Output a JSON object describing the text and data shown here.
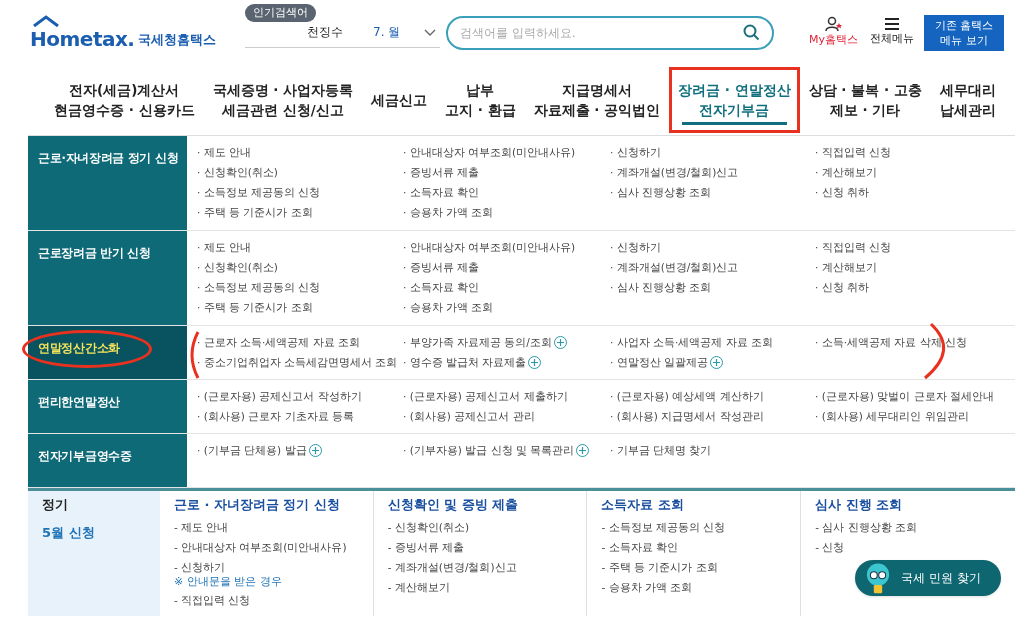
{
  "header": {
    "logo": {
      "wordmark": "Hometax.",
      "name": "국세청홈택스"
    },
    "popular": {
      "badge": "인기검색어",
      "items": [
        "천징수",
        "7. 월"
      ]
    },
    "search": {
      "placeholder": "검색어를 입력하세요."
    },
    "my_link": "My홈택스",
    "menu_link": "전체메뉴",
    "legacy_button": [
      "기존 홈택스",
      "메뉴 보기"
    ]
  },
  "nav": [
    {
      "lines": [
        "전자(세금)계산서",
        "현금영수증 · 신용카드"
      ],
      "selected": false,
      "highlighted": false
    },
    {
      "lines": [
        "국세증명 · 사업자등록",
        "세금관련 신청/신고"
      ],
      "selected": false,
      "highlighted": false
    },
    {
      "lines": [
        "세금신고"
      ],
      "selected": false,
      "highlighted": false
    },
    {
      "lines": [
        "납부",
        "고지 · 환급"
      ],
      "selected": false,
      "highlighted": false
    },
    {
      "lines": [
        "지급명세서",
        "자료제출 · 공익법인"
      ],
      "selected": false,
      "highlighted": false
    },
    {
      "lines": [
        "장려금 · 연말정산",
        "전자기부금"
      ],
      "selected": true,
      "highlighted": true
    },
    {
      "lines": [
        "상담 · 불복 · 고충",
        "제보 · 기타"
      ],
      "selected": false,
      "highlighted": false
    },
    {
      "lines": [
        "세무대리",
        "납세관리"
      ],
      "selected": false,
      "highlighted": false
    }
  ],
  "menu": [
    {
      "title": "근로·자녀장려금 정기 신청",
      "selected": false,
      "highlighted": false,
      "items": [
        {
          "label": "· 제도 안내",
          "plus": false
        },
        {
          "label": "· 안내대상자 여부조회(미안내사유)",
          "plus": false
        },
        {
          "label": "· 신청하기",
          "plus": false
        },
        {
          "label": "· 직접입력 신청",
          "plus": false
        },
        {
          "label": "· 신청확인(취소)",
          "plus": false
        },
        {
          "label": "· 증빙서류 제출",
          "plus": false
        },
        {
          "label": "· 계좌개설(변경/철회)신고",
          "plus": false
        },
        {
          "label": "· 계산해보기",
          "plus": false
        },
        {
          "label": "· 소득정보 제공동의 신청",
          "plus": false
        },
        {
          "label": "· 소득자료 확인",
          "plus": false
        },
        {
          "label": "· 심사 진행상황 조회",
          "plus": false
        },
        {
          "label": "· 신청 취하",
          "plus": false
        },
        {
          "label": "· 주택 등 기준시가 조회",
          "plus": false
        },
        {
          "label": "· 승용차 가액 조회",
          "plus": false
        }
      ]
    },
    {
      "title": "근로장려금 반기 신청",
      "selected": false,
      "highlighted": false,
      "items": [
        {
          "label": "· 제도 안내",
          "plus": false
        },
        {
          "label": "· 안내대상자 여부조회(미안내사유)",
          "plus": false
        },
        {
          "label": "· 신청하기",
          "plus": false
        },
        {
          "label": "· 직접입력 신청",
          "plus": false
        },
        {
          "label": "· 신청확인(취소)",
          "plus": false
        },
        {
          "label": "· 증빙서류 제출",
          "plus": false
        },
        {
          "label": "· 계좌개설(변경/철회)신고",
          "plus": false
        },
        {
          "label": "· 계산해보기",
          "plus": false
        },
        {
          "label": "· 소득정보 제공동의 신청",
          "plus": false
        },
        {
          "label": "· 소득자료 확인",
          "plus": false
        },
        {
          "label": "· 심사 진행상황 조회",
          "plus": false
        },
        {
          "label": "· 신청 취하",
          "plus": false
        },
        {
          "label": "· 주택 등 기준시가 조회",
          "plus": false
        },
        {
          "label": "· 승용차 가액 조회",
          "plus": false
        }
      ]
    },
    {
      "title": "연말정산간소화",
      "selected": true,
      "highlighted": true,
      "items": [
        {
          "label": "· 근로자 소득·세액공제 자료 조회",
          "plus": false
        },
        {
          "label": "· 부양가족 자료제공 동의/조회",
          "plus": true
        },
        {
          "label": "· 사업자 소득·세액공제 자료 조회",
          "plus": false
        },
        {
          "label": "· 소득·세액공제 자료 삭제 신청",
          "plus": false
        },
        {
          "label": "· 중소기업취업자 소득세감면명세서 조회",
          "plus": false
        },
        {
          "label": "· 영수증 발급처 자료제출",
          "plus": true
        },
        {
          "label": "· 연말정산 일괄제공",
          "plus": true
        }
      ]
    },
    {
      "title": "편리한연말정산",
      "selected": false,
      "highlighted": false,
      "items": [
        {
          "label": "· (근로자용) 공제신고서 작성하기",
          "plus": false
        },
        {
          "label": "· (근로자용) 공제신고서 제출하기",
          "plus": false
        },
        {
          "label": "· (근로자용) 예상세액 계산하기",
          "plus": false
        },
        {
          "label": "· (근로자용) 맞벌이 근로자 절세안내",
          "plus": false
        },
        {
          "label": "· (회사용) 근로자 기초자료 등록",
          "plus": false
        },
        {
          "label": "· (회사용) 공제신고서 관리",
          "plus": false
        },
        {
          "label": "· (회사용) 지급명세서 작성관리",
          "plus": false
        },
        {
          "label": "· (회사용) 세무대리인 위임관리",
          "plus": false
        }
      ]
    },
    {
      "title": "전자기부금영수증",
      "selected": false,
      "highlighted": false,
      "items": [
        {
          "label": "· (기부금 단체용) 발급",
          "plus": true
        },
        {
          "label": "· (기부자용) 발급 신청 및 목록관리",
          "plus": true
        },
        {
          "label": "· 기부금 단체명 찾기",
          "plus": false
        }
      ]
    }
  ],
  "below": {
    "side": {
      "title": "정기",
      "subtitle": "5월 신청"
    },
    "columns": [
      {
        "heading": "근로 · 자녀장려금 정기 신청",
        "items": [
          {
            "label": "- 제도 안내",
            "kind": "link"
          },
          {
            "label": "- 안내대상자 여부조회(미안내사유)",
            "kind": "link"
          },
          {
            "label": "- 신청하기",
            "kind": "link"
          },
          {
            "label": "※ 안내문을 받은 경우",
            "kind": "note"
          },
          {
            "label": "- 직접입력 신청",
            "kind": "link"
          }
        ]
      },
      {
        "heading": "신청확인 및 증빙 제출",
        "items": [
          {
            "label": "- 신청확인(취소)",
            "kind": "link"
          },
          {
            "label": "- 증빙서류 제출",
            "kind": "link"
          },
          {
            "label": "- 계좌개설(변경/철회)신고",
            "kind": "link"
          },
          {
            "label": "- 계산해보기",
            "kind": "link"
          }
        ]
      },
      {
        "heading": "소득자료 조회",
        "items": [
          {
            "label": "- 소득정보 제공동의 신청",
            "kind": "link"
          },
          {
            "label": "- 소득자료 확인",
            "kind": "link"
          },
          {
            "label": "- 주택 등 기준시가 조회",
            "kind": "link"
          },
          {
            "label": "- 승용차 가액 조회",
            "kind": "link"
          }
        ]
      },
      {
        "heading": "심사 진행 조회",
        "items": [
          {
            "label": "- 심사 진행상황 조회",
            "kind": "link"
          },
          {
            "label": "- 신청",
            "kind": "link"
          }
        ]
      }
    ]
  },
  "chatbot": {
    "label": "국세 민원 찾기"
  }
}
